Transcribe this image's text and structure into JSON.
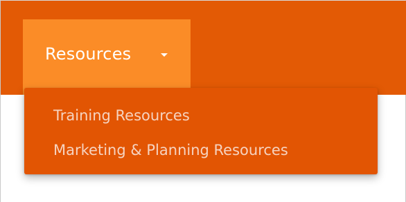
{
  "nav": {
    "menu_label": "Resources",
    "caret_icon": "caret-down-icon"
  },
  "dropdown": {
    "items": [
      {
        "label": "Training Resources"
      },
      {
        "label": "Marketing & Planning Resources"
      }
    ]
  },
  "colors": {
    "navbar_bg": "#e35a05",
    "active_tab_bg": "#fb8c27",
    "dropdown_bg": "#e25503",
    "dropdown_text": "#f6d3c0",
    "nav_text": "#ffffff"
  }
}
